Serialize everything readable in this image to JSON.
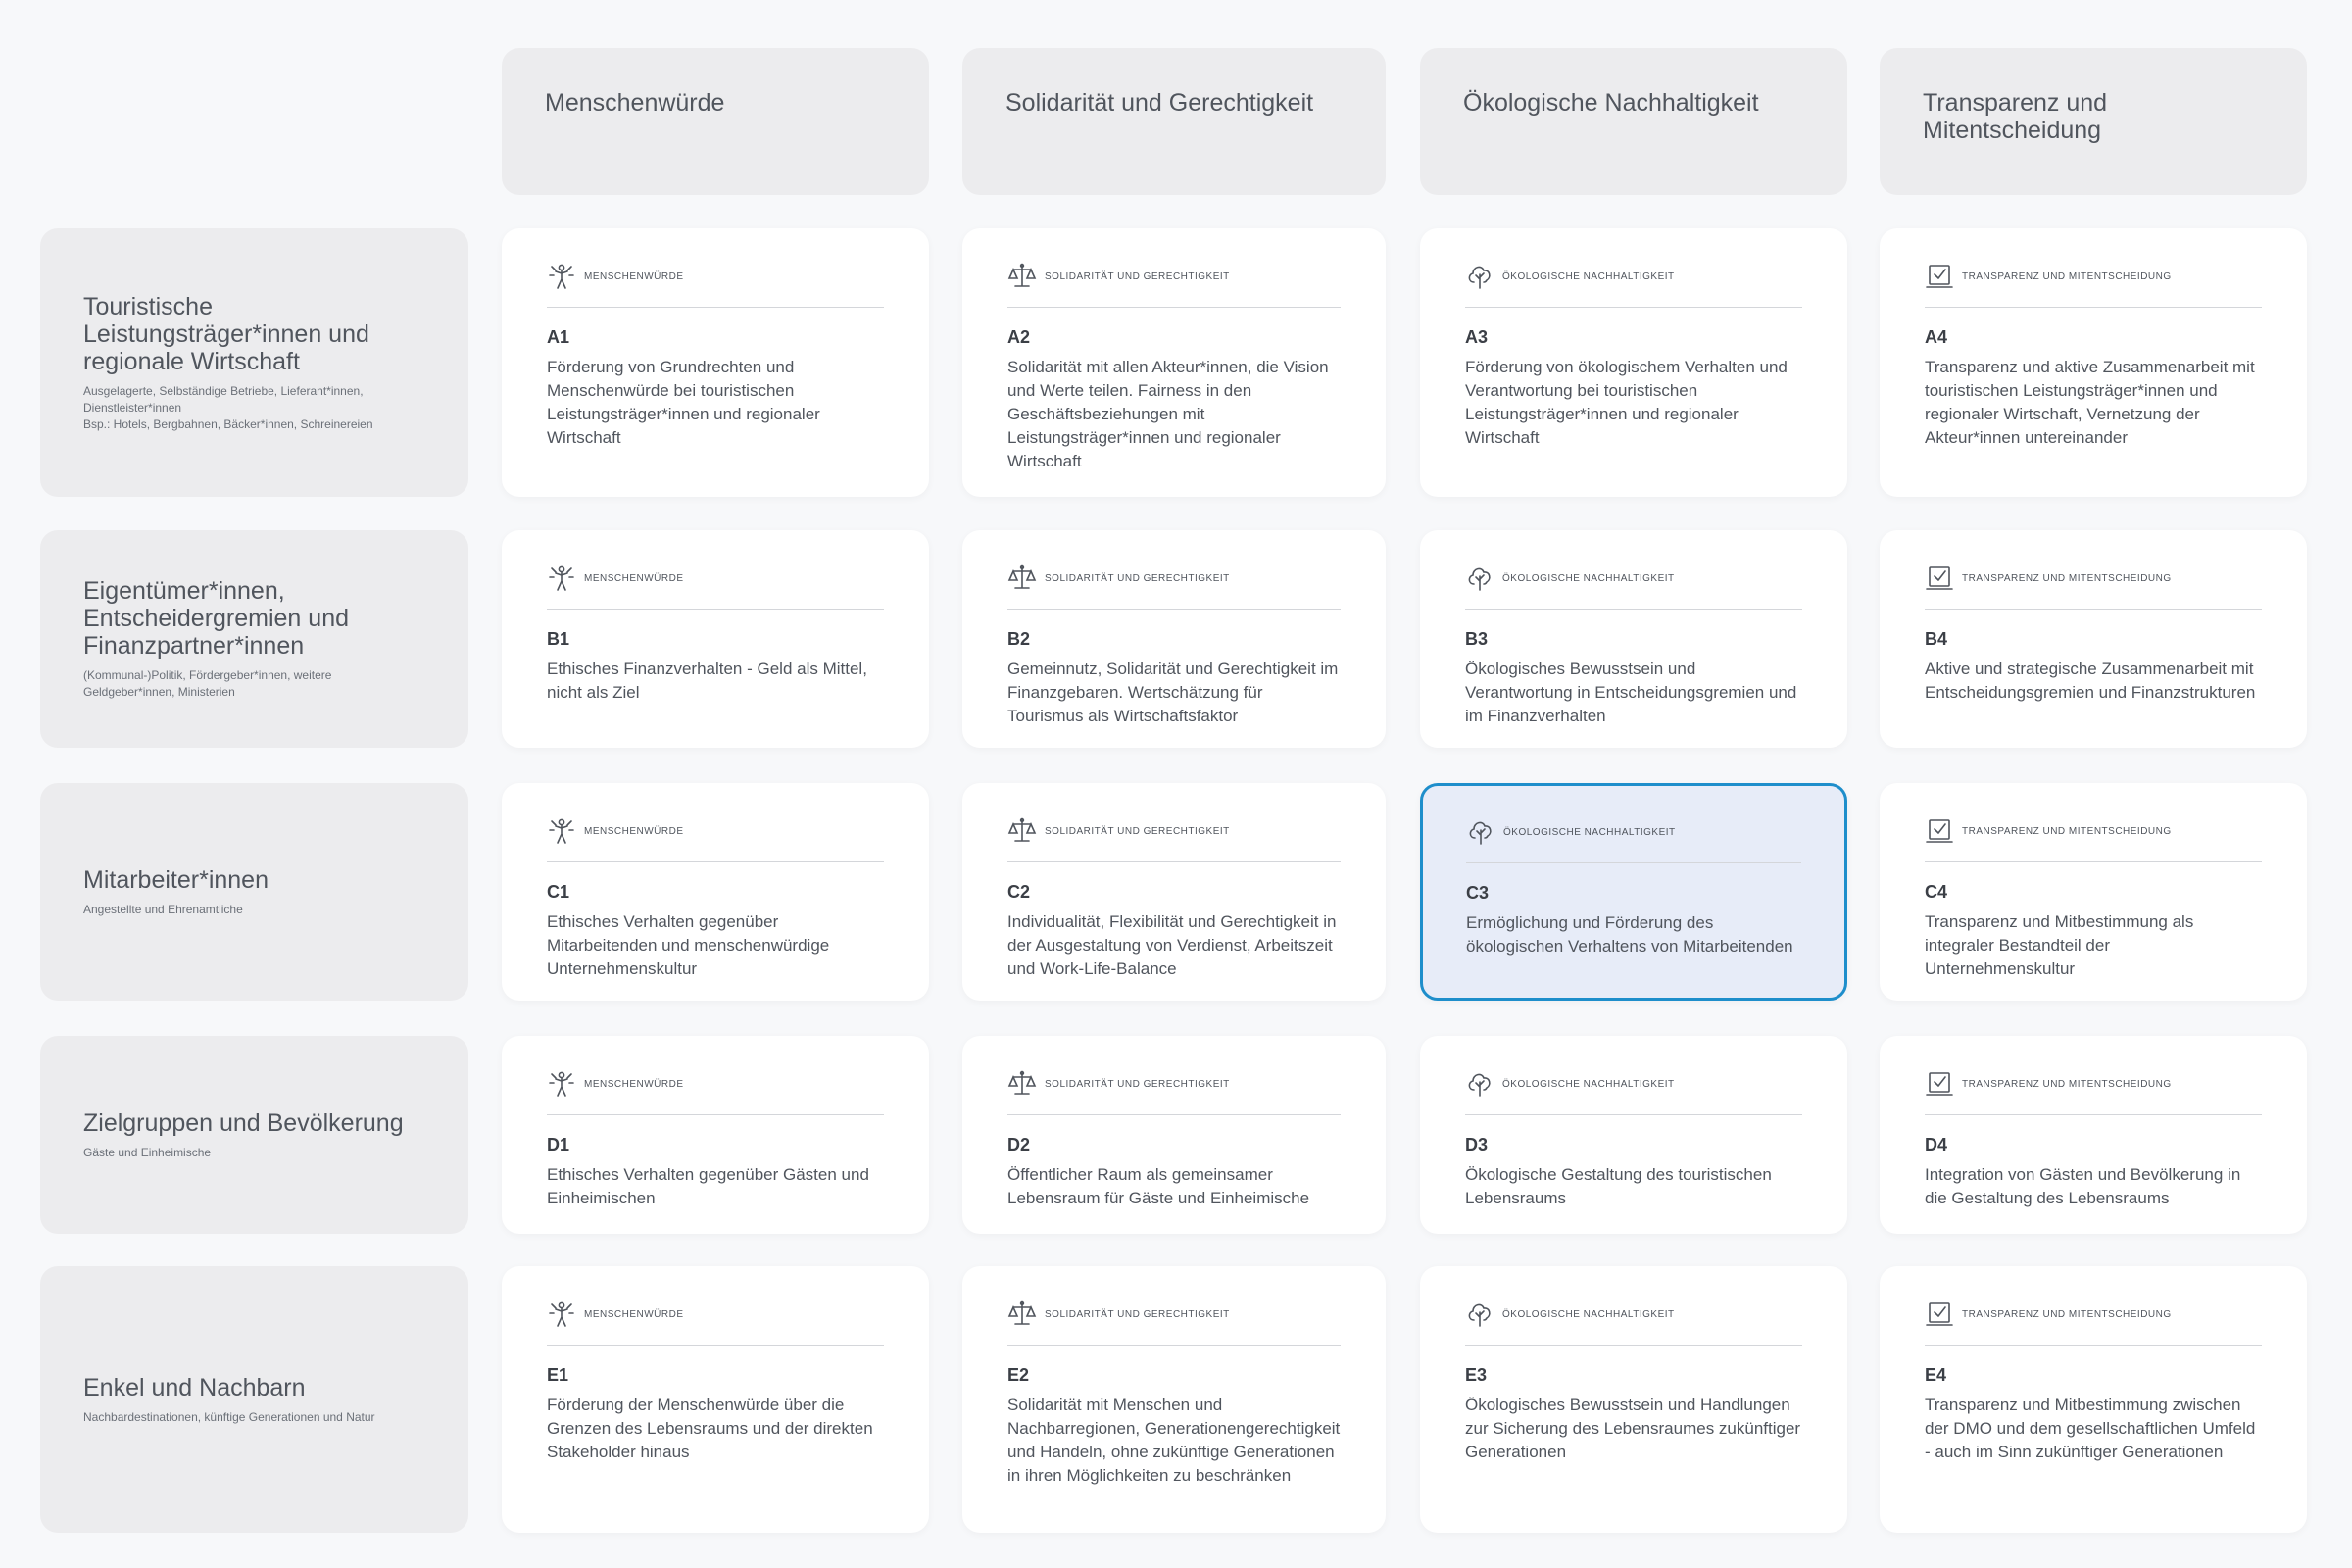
{
  "columns": [
    {
      "label": "Menschenwürde",
      "category": "Menschenwürde",
      "icon": "person-icon"
    },
    {
      "label": "Solidarität und Gerechtigkeit",
      "category": "Solidarität und Gerechtigkeit",
      "icon": "scales-icon"
    },
    {
      "label": "Ökologische Nachhaltigkeit",
      "category": "Ökologische Nachhaltigkeit",
      "icon": "tree-icon"
    },
    {
      "label": "Transparenz und Mitentscheidung",
      "category": "Transparenz und Mitentscheidung",
      "icon": "ballot-icon"
    }
  ],
  "rows": [
    {
      "title": "Touristische Leistungsträger*innen und regionale Wirtschaft",
      "subtitle": "Ausgelagerte, Selbständige Betriebe, Lieferant*innen, Dienstleister*innen\nBsp.: Hotels, Bergbahnen, Bäcker*innen, Schreinereien",
      "cells": [
        {
          "code": "A1",
          "text": "Förderung von Grundrechten und Menschenwürde bei touristischen Leistungsträger*innen und regionaler Wirtschaft"
        },
        {
          "code": "A2",
          "text": "Solidarität mit allen Akteur*innen, die Vision und Werte teilen. Fairness in den Geschäftsbeziehungen mit Leistungsträger*innen und regionaler Wirtschaft"
        },
        {
          "code": "A3",
          "text": "Förderung von ökologischem Verhalten und Verantwortung bei touristischen Leistungsträger*innen und regionaler Wirtschaft"
        },
        {
          "code": "A4",
          "text": "Transparenz und aktive Zusammenarbeit mit touristischen Leistungsträger*innen und regionaler Wirtschaft, Vernetzung der Akteur*innen untereinander"
        }
      ]
    },
    {
      "title": "Eigentümer*innen, Entscheidergremien und Finanzpartner*innen",
      "subtitle": "(Kommunal-)Politik, Fördergeber*innen, weitere Geldgeber*innen, Ministerien",
      "cells": [
        {
          "code": "B1",
          "text": "Ethisches Finanzverhalten - Geld als Mittel, nicht als Ziel"
        },
        {
          "code": "B2",
          "text": "Gemeinnutz, Solidarität und Gerechtigkeit im Finanzgebaren. Wertschätzung für Tourismus als Wirtschaftsfaktor"
        },
        {
          "code": "B3",
          "text": "Ökologisches Bewusstsein und Verantwortung in Entscheidungsgremien und im Finanzverhalten"
        },
        {
          "code": "B4",
          "text": "Aktive und strategische Zusammenarbeit mit Entscheidungsgremien und Finanzstrukturen"
        }
      ]
    },
    {
      "title": "Mitarbeiter*innen",
      "subtitle": "Angestellte und Ehrenamtliche",
      "cells": [
        {
          "code": "C1",
          "text": "Ethisches Verhalten gegenüber Mitarbeitenden und menschenwürdige Unternehmenskultur"
        },
        {
          "code": "C2",
          "text": "Individualität, Flexibilität und Gerechtigkeit in der Ausgestaltung von Verdienst, Arbeitszeit und Work-Life-Balance"
        },
        {
          "code": "C3",
          "text": "Ermöglichung und Förderung des ökologischen Verhaltens von Mitarbeitenden"
        },
        {
          "code": "C4",
          "text": "Transparenz und Mitbestimmung als integraler Bestandteil der Unternehmenskultur"
        }
      ]
    },
    {
      "title": "Zielgruppen und Bevölkerung",
      "subtitle": "Gäste und Einheimische",
      "cells": [
        {
          "code": "D1",
          "text": "Ethisches Verhalten gegenüber Gästen und Einheimischen"
        },
        {
          "code": "D2",
          "text": "Öffentlicher Raum als gemeinsamer Lebensraum für Gäste und Einheimische"
        },
        {
          "code": "D3",
          "text": "Ökologische Gestaltung des touristischen Lebensraums"
        },
        {
          "code": "D4",
          "text": "Integration von Gästen und Bevölkerung in die Gestaltung des Lebensraums"
        }
      ]
    },
    {
      "title": "Enkel und Nachbarn",
      "subtitle": "Nachbardestinationen, künftige Generationen und Natur",
      "cells": [
        {
          "code": "E1",
          "text": "Förderung der Menschenwürde über die Grenzen des Lebensraums und der direkten Stakeholder hinaus"
        },
        {
          "code": "E2",
          "text": "Solidarität mit Menschen und Nachbarregionen, Generationengerechtigkeit und Handeln, ohne zukünftige Generationen in ihren Möglichkeiten zu beschränken"
        },
        {
          "code": "E3",
          "text": "Ökologisches Bewusstsein und Handlungen zur Sicherung des Lebensraumes zukünftiger Generationen"
        },
        {
          "code": "E4",
          "text": "Transparenz und Mitbestimmung zwischen der DMO und dem gesellschaftlichen Umfeld - auch im Sinn zukünftiger Generationen"
        }
      ]
    }
  ],
  "selected": "C3",
  "colors": {
    "selected_border": "#1e8ecb",
    "selected_bg": "#e7ecf8"
  }
}
